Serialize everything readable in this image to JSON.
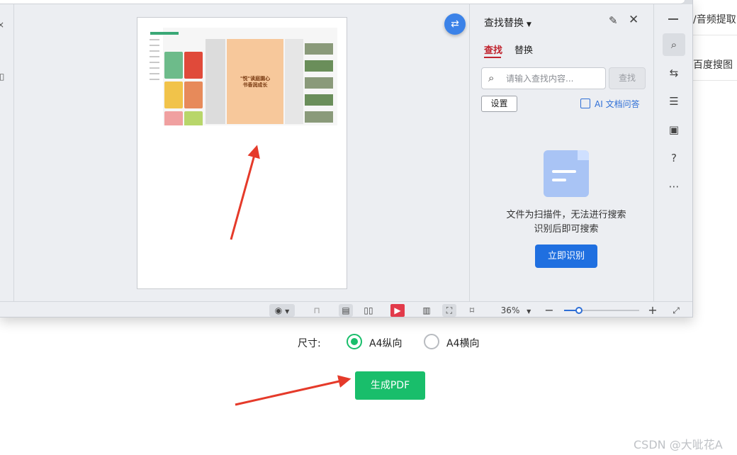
{
  "bg": {
    "right_row1": "/音频提取",
    "right_row2": "百度搜图"
  },
  "left_rail": {
    "glyph1": "×",
    "glyph2": "◫"
  },
  "sidebar": {
    "title": "查找替换",
    "tabs": [
      {
        "label": "查找"
      },
      {
        "label": "替换"
      }
    ],
    "search": {
      "placeholder": "请输入查找内容..."
    },
    "find_label": "查找",
    "settings_label": "设置",
    "ai_link": "AI 文档问答",
    "scan_msg_line1": "文件为扫描件，无法进行搜索",
    "scan_msg_line2": "识别后即可搜索",
    "recognize_label": "立即识别"
  },
  "thumb": {
    "title_line1": "\"悦\"读庭園心",
    "title_line2": "书香润成长"
  },
  "statusbar": {
    "zoom_label": "36%",
    "zoom_value": 0.2
  },
  "form": {
    "size_label": "尺寸:",
    "options": [
      {
        "label": "A4纵向",
        "checked": true
      },
      {
        "label": "A4横向",
        "checked": false
      }
    ],
    "generate_label": "生成PDF"
  },
  "watermark": "CSDN @大呲花A",
  "colors": {
    "accent_blue": "#1f6fe0",
    "accent_green": "#19be6b",
    "tab_red": "#c0242f",
    "arrow_red": "#e53a2a"
  },
  "icons": {
    "minimize": "minimize-icon",
    "search": "search-icon",
    "translate": "translate-icon",
    "sliders": "sliders-icon",
    "book_search": "book-search-icon",
    "help": "help-icon",
    "more": "more-icon"
  }
}
